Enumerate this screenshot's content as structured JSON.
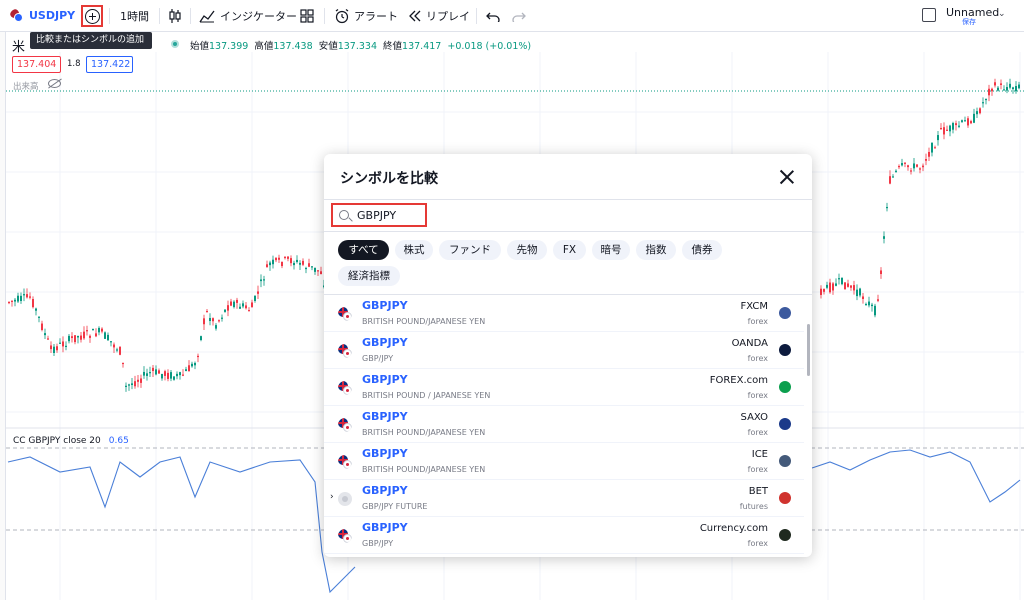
{
  "toolbar": {
    "symbol": "USDJPY",
    "interval": "1時間",
    "indicators": "インジケーター",
    "alert": "アラート",
    "replay": "リプレイ",
    "layout_name": "Unnamed",
    "layout_save": "保存"
  },
  "tooltip": "比較またはシンボルの追加",
  "legend": {
    "open_label": "始値",
    "open": "137.399",
    "high_label": "高値",
    "high": "137.438",
    "low_label": "安値",
    "low": "137.334",
    "close_label": "終値",
    "close": "137.417",
    "change": "+0.018 (+0.01%)",
    "sell_price": "137.404",
    "spread": "1.8",
    "buy_price": "137.422",
    "volume_label": "出来高"
  },
  "oscillator": {
    "label": "CC GBPJPY close 20",
    "value": "0.65"
  },
  "dialog": {
    "title": "シンボルを比較",
    "search_value": "GBPJPY",
    "chips": [
      "すべて",
      "株式",
      "ファンド",
      "先物",
      "FX",
      "暗号",
      "指数",
      "債券",
      "経済指標"
    ],
    "active_chip": "すべて",
    "results": [
      {
        "symbol": "GBPJPY",
        "description": "BRITISH POUND/JAPANESE YEN",
        "exchange": "FXCM",
        "type": "forex",
        "logo_color": "#3d5a9e"
      },
      {
        "symbol": "GBPJPY",
        "description": "GBP/JPY",
        "exchange": "OANDA",
        "type": "forex",
        "logo_color": "#0d1b3e"
      },
      {
        "symbol": "GBPJPY",
        "description": "BRITISH POUND / JAPANESE YEN",
        "exchange": "FOREX.com",
        "type": "forex",
        "logo_color": "#0c9f4e"
      },
      {
        "symbol": "GBPJPY",
        "description": "BRITISH POUND/JAPANESE YEN",
        "exchange": "SAXO",
        "type": "forex",
        "logo_color": "#1b3a8a"
      },
      {
        "symbol": "GBPJPY",
        "description": "BRITISH POUND/JAPANESE YEN",
        "exchange": "ICE",
        "type": "forex",
        "logo_color": "#445a7a"
      },
      {
        "symbol": "GBPJPY",
        "description": "GBP/JPY FUTURE",
        "exchange": "BET",
        "type": "futures",
        "logo_color": "#d0332e"
      },
      {
        "symbol": "GBPJPY",
        "description": "GBP/JPY",
        "exchange": "Currency.com",
        "type": "forex",
        "logo_color": "#1f2a1f"
      }
    ]
  },
  "colors": {
    "up": "#089981",
    "down": "#f23645",
    "accent": "#2962ff",
    "highlight": "#e53935",
    "oscillator_line": "#4a7fd8"
  }
}
